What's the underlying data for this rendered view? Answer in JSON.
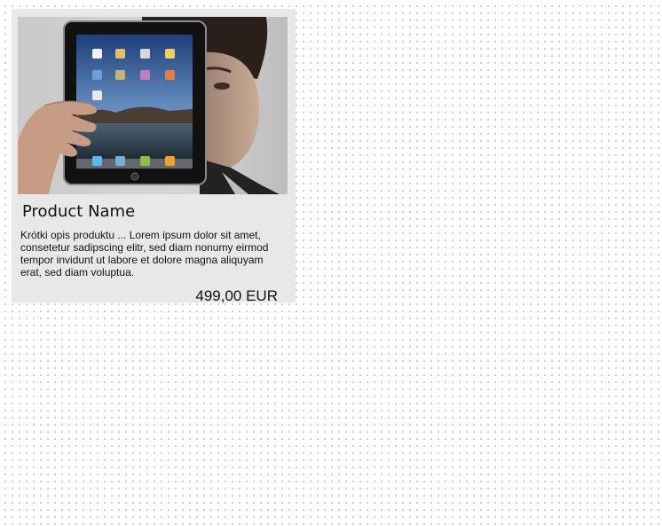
{
  "product": {
    "name": "Product Name",
    "description": "Krótki opis produktu ... Lorem ipsum dolor sit amet, consetetur sadipscing elitr, sed diam nonumy eirmod tempor invidunt ut labore et dolore magna aliquyam erat, sed diam voluptua.",
    "price": "499,00 EUR",
    "image_icon": "tablet-photo"
  },
  "colors": {
    "card_background": "#e8e8e8",
    "page_dots": "#bdbdbd"
  }
}
